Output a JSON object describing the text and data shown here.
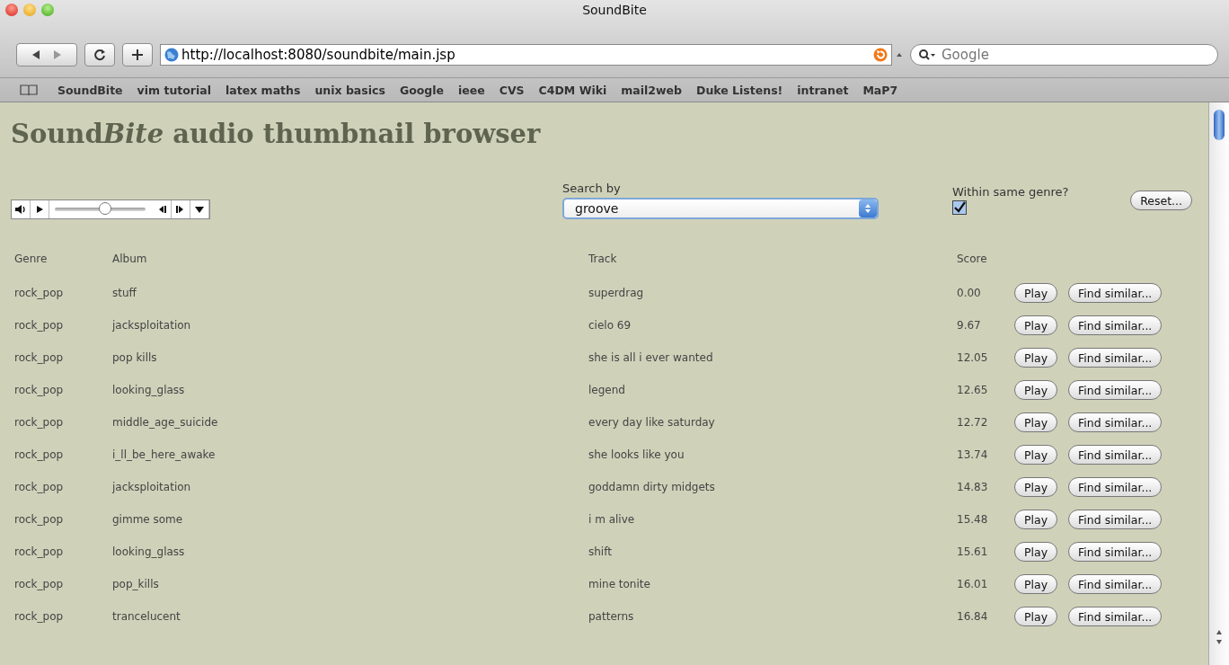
{
  "window": {
    "title": "SoundBite"
  },
  "toolbar": {
    "url": "http://localhost:8080/soundbite/main.jsp",
    "search_placeholder": "Google"
  },
  "bookmarks": [
    "SoundBite",
    "vim tutorial",
    "latex maths",
    "unix basics",
    "Google",
    "ieee",
    "CVS",
    "C4DM Wiki",
    "mail2web",
    "Duke Listens!",
    "intranet",
    "MaP7"
  ],
  "page": {
    "title": [
      {
        "text": "Sound",
        "italic": false
      },
      {
        "text": "Bite",
        "italic": true
      },
      {
        "text": " audio thumbnail browser",
        "italic": false
      }
    ],
    "player": {
      "level": 0.55
    },
    "search_by": {
      "label": "Search by",
      "value": "groove"
    },
    "same_genre": {
      "label": "Within same genre?",
      "checked": true
    },
    "reset_button": "Reset...",
    "table": {
      "columns": [
        "Genre",
        "Album",
        "Track",
        "Score"
      ],
      "rows": [
        {
          "genre": "rock_pop",
          "album": "stuff",
          "track": "superdrag",
          "score": "0.00",
          "play": "Play",
          "find": "Find similar..."
        },
        {
          "genre": "rock_pop",
          "album": "jacksploitation",
          "track": "cielo 69",
          "score": "9.67",
          "play": "Play",
          "find": "Find similar..."
        },
        {
          "genre": "rock_pop",
          "album": "pop kills",
          "track": "she is all i ever wanted",
          "score": "12.05",
          "play": "Play",
          "find": "Find similar..."
        },
        {
          "genre": "rock_pop",
          "album": "looking_glass",
          "track": "legend",
          "score": "12.65",
          "play": "Play",
          "find": "Find similar..."
        },
        {
          "genre": "rock_pop",
          "album": "middle_age_suicide",
          "track": "every day like saturday",
          "score": "12.72",
          "play": "Play",
          "find": "Find similar..."
        },
        {
          "genre": "rock_pop",
          "album": "i_ll_be_here_awake",
          "track": "she looks like you",
          "score": "13.74",
          "play": "Play",
          "find": "Find similar..."
        },
        {
          "genre": "rock_pop",
          "album": "jacksploitation",
          "track": "goddamn dirty midgets",
          "score": "14.83",
          "play": "Play",
          "find": "Find similar..."
        },
        {
          "genre": "rock_pop",
          "album": "gimme some",
          "track": "i m alive",
          "score": "15.48",
          "play": "Play",
          "find": "Find similar..."
        },
        {
          "genre": "rock_pop",
          "album": "looking_glass",
          "track": "shift",
          "score": "15.61",
          "play": "Play",
          "find": "Find similar..."
        },
        {
          "genre": "rock_pop",
          "album": "pop_kills",
          "track": "mine tonite",
          "score": "16.01",
          "play": "Play",
          "find": "Find similar..."
        },
        {
          "genre": "rock_pop",
          "album": "trancelucent",
          "track": "patterns",
          "score": "16.84",
          "play": "Play",
          "find": "Find similar..."
        }
      ]
    }
  }
}
